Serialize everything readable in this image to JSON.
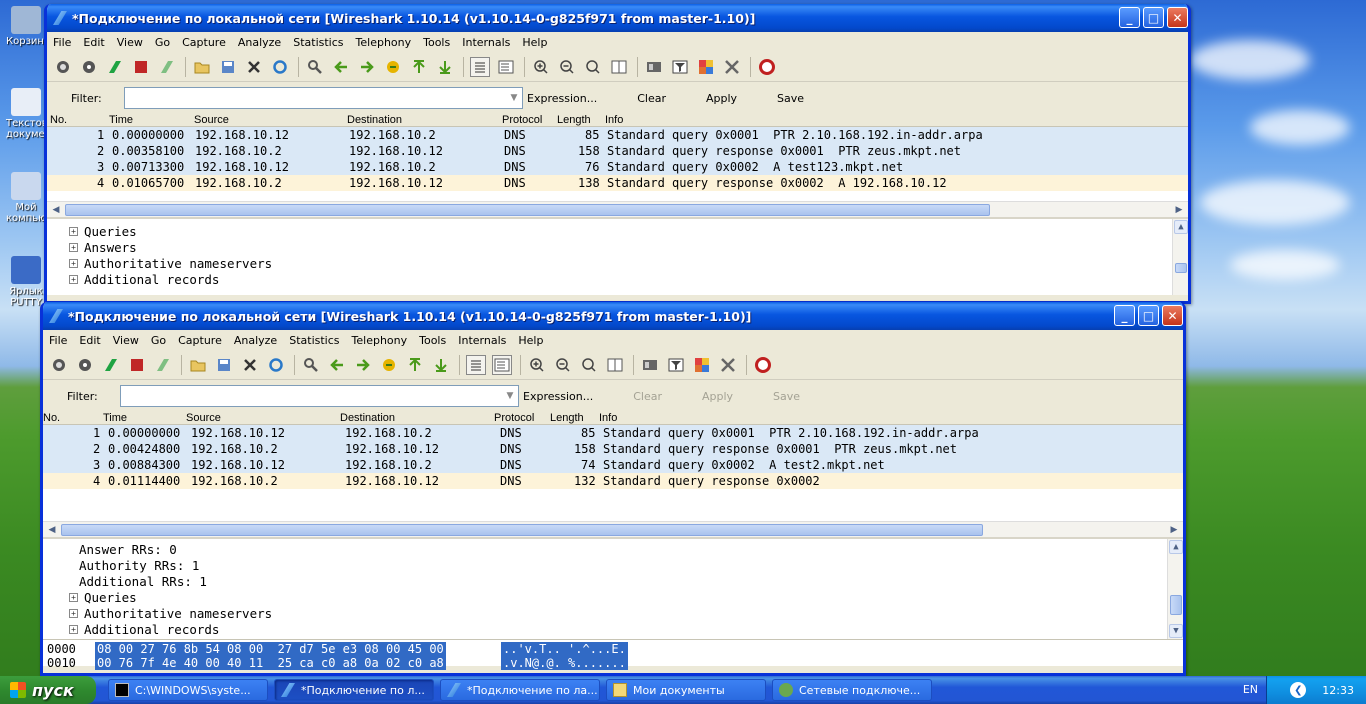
{
  "desktop": {
    "icons": [
      {
        "label": "Корзина",
        "color": "#9fb7d6"
      },
      {
        "label": "Текстовый документ",
        "color": "#e8eef7"
      },
      {
        "label": "Мой компьютер",
        "color": "#c9d8ee"
      },
      {
        "label": "Ярлык PUTTY",
        "color": "#3b6bc6"
      }
    ]
  },
  "windows": [
    {
      "title": "*Подключение по локальной сети   [Wireshark 1.10.14  (v1.10.14-0-g825f971 from master-1.10)]",
      "menu": [
        "File",
        "Edit",
        "View",
        "Go",
        "Capture",
        "Analyze",
        "Statistics",
        "Telephony",
        "Tools",
        "Internals",
        "Help"
      ],
      "filter": {
        "label": "Filter:",
        "value": "",
        "expression": "Expression...",
        "clear": "Clear",
        "apply": "Apply",
        "save": "Save"
      },
      "columns": [
        "No.",
        "Time",
        "Source",
        "Destination",
        "Protocol",
        "Length",
        "Info"
      ],
      "packets": [
        {
          "no": "1",
          "time": "0.00000000",
          "src": "192.168.10.12",
          "dst": "192.168.10.2",
          "proto": "DNS",
          "len": "85",
          "info": "Standard query 0x0001  PTR 2.10.168.192.in-addr.arpa"
        },
        {
          "no": "2",
          "time": "0.00358100",
          "src": "192.168.10.2",
          "dst": "192.168.10.12",
          "proto": "DNS",
          "len": "158",
          "info": "Standard query response 0x0001  PTR zeus.mkpt.net"
        },
        {
          "no": "3",
          "time": "0.00713300",
          "src": "192.168.10.12",
          "dst": "192.168.10.2",
          "proto": "DNS",
          "len": "76",
          "info": "Standard query 0x0002  A test123.mkpt.net"
        },
        {
          "no": "4",
          "time": "0.01065700",
          "src": "192.168.10.2",
          "dst": "192.168.10.12",
          "proto": "DNS",
          "len": "138",
          "info": "Standard query response 0x0002  A 192.168.10.12"
        }
      ],
      "details": [
        "Queries",
        "Answers",
        "Authoritative nameservers",
        "Additional records"
      ]
    },
    {
      "title": "*Подключение по локальной сети   [Wireshark 1.10.14  (v1.10.14-0-g825f971 from master-1.10)]",
      "menu": [
        "File",
        "Edit",
        "View",
        "Go",
        "Capture",
        "Analyze",
        "Statistics",
        "Telephony",
        "Tools",
        "Internals",
        "Help"
      ],
      "filter": {
        "label": "Filter:",
        "value": "",
        "expression": "Expression...",
        "clear": "Clear",
        "apply": "Apply",
        "save": "Save"
      },
      "columns": [
        "No.",
        "Time",
        "Source",
        "Destination",
        "Protocol",
        "Length",
        "Info"
      ],
      "packets": [
        {
          "no": "1",
          "time": "0.00000000",
          "src": "192.168.10.12",
          "dst": "192.168.10.2",
          "proto": "DNS",
          "len": "85",
          "info": "Standard query 0x0001  PTR 2.10.168.192.in-addr.arpa"
        },
        {
          "no": "2",
          "time": "0.00424800",
          "src": "192.168.10.2",
          "dst": "192.168.10.12",
          "proto": "DNS",
          "len": "158",
          "info": "Standard query response 0x0001  PTR zeus.mkpt.net"
        },
        {
          "no": "3",
          "time": "0.00884300",
          "src": "192.168.10.12",
          "dst": "192.168.10.2",
          "proto": "DNS",
          "len": "74",
          "info": "Standard query 0x0002  A test2.mkpt.net"
        },
        {
          "no": "4",
          "time": "0.01114400",
          "src": "192.168.10.2",
          "dst": "192.168.10.12",
          "proto": "DNS",
          "len": "132",
          "info": "Standard query response 0x0002"
        }
      ],
      "details_plain": [
        "Answer RRs: 0",
        "Authority RRs: 1",
        "Additional RRs: 1"
      ],
      "details": [
        "Queries",
        "Authoritative nameservers",
        "Additional records"
      ],
      "hex": [
        {
          "off": "0000",
          "bytes": "08 00 27 76 8b 54 08 00  27 d7 5e e3 08 00 45 00",
          "ascii": "..'v.T.. '.^...E."
        },
        {
          "off": "0010",
          "bytes": "00 76 7f 4e 40 00 40 11  25 ca c0 a8 0a 02 c0 a8",
          "ascii": ".v.N@.@. %......."
        }
      ]
    }
  ],
  "taskbar": {
    "start": "пуск",
    "tasks": [
      {
        "label": "C:\\WINDOWS\\syste...",
        "icon": "cmd-icon"
      },
      {
        "label": "*Подключение по л...",
        "icon": "wireshark-icon",
        "active": true
      },
      {
        "label": "*Подключение по ла...",
        "icon": "wireshark-icon"
      },
      {
        "label": "Мои документы",
        "icon": "folder-icon"
      },
      {
        "label": "Сетевые подключе...",
        "icon": "network-icon"
      }
    ],
    "lang": "EN",
    "clock": "12:33"
  }
}
